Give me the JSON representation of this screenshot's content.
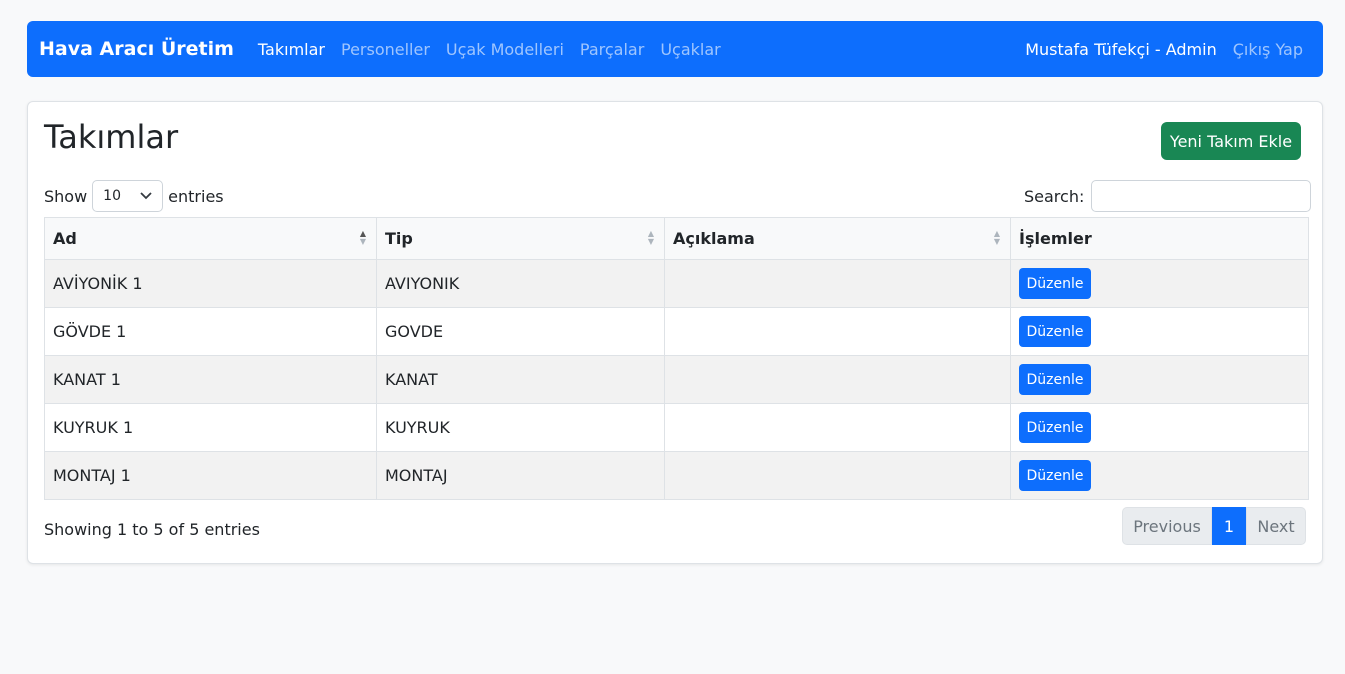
{
  "navbar": {
    "brand": "Hava Aracı Üretim",
    "links": [
      "Takımlar",
      "Personeller",
      "Uçak Modelleri",
      "Parçalar",
      "Uçaklar"
    ],
    "user": "Mustafa Tüfekçi - Admin",
    "logout": "Çıkış Yap"
  },
  "page": {
    "title": "Takımlar",
    "add_button": "Yeni Takım Ekle"
  },
  "controls": {
    "show_label": "Show",
    "entries_value": "10",
    "entries_label": "entries",
    "search_label": "Search:",
    "search_value": ""
  },
  "table": {
    "headers": [
      "Ad",
      "Tip",
      "Açıklama",
      "İşlemler"
    ],
    "edit_label": "Düzenle",
    "rows": [
      {
        "ad": "AVİYONİK 1",
        "tip": "AVIYONIK",
        "aciklama": ""
      },
      {
        "ad": "GÖVDE 1",
        "tip": "GOVDE",
        "aciklama": ""
      },
      {
        "ad": "KANAT 1",
        "tip": "KANAT",
        "aciklama": ""
      },
      {
        "ad": "KUYRUK 1",
        "tip": "KUYRUK",
        "aciklama": ""
      },
      {
        "ad": "MONTAJ 1",
        "tip": "MONTAJ",
        "aciklama": ""
      }
    ]
  },
  "footer": {
    "info": "Showing 1 to 5 of 5 entries",
    "previous": "Previous",
    "current_page": "1",
    "next": "Next"
  },
  "colors": {
    "primary": "#0d6efd",
    "success": "#198754"
  }
}
